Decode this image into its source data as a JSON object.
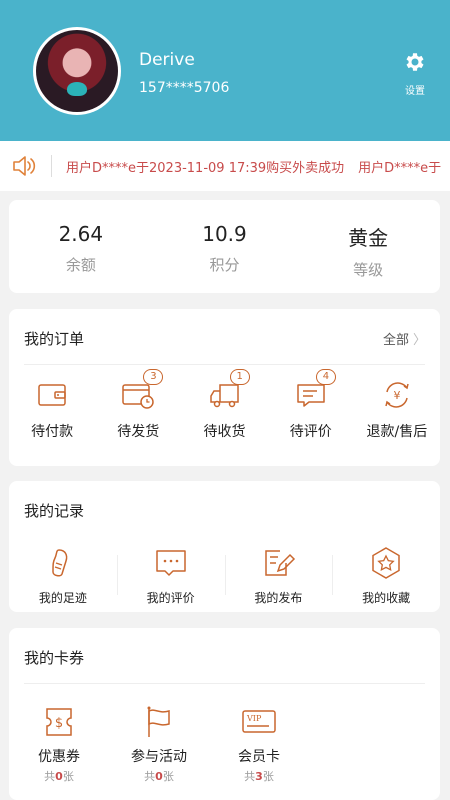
{
  "colors": {
    "header_bg": "#4ab3cb",
    "accent": "#c9672e",
    "marquee_text": "#c84b4b"
  },
  "header": {
    "username": "Derive",
    "phone": "157****5706",
    "settings_label": "设置"
  },
  "marquee": {
    "icon": "speaker-icon",
    "items": [
      "用户D****e于2023-11-09 17:39购买外卖成功",
      "用户D****e于"
    ]
  },
  "stats": [
    {
      "value": "2.64",
      "label": "余额"
    },
    {
      "value": "10.9",
      "label": "积分"
    },
    {
      "value": "黄金",
      "label": "等级"
    }
  ],
  "orders": {
    "title": "我的订单",
    "more": "全部",
    "items": [
      {
        "label": "待付款",
        "icon": "wallet-icon",
        "badge": ""
      },
      {
        "label": "待发货",
        "icon": "card-clock-icon",
        "badge": "3"
      },
      {
        "label": "待收货",
        "icon": "truck-icon",
        "badge": "1"
      },
      {
        "label": "待评价",
        "icon": "comment-icon",
        "badge": "4"
      },
      {
        "label": "退款/售后",
        "icon": "refund-icon",
        "badge": ""
      }
    ]
  },
  "records": {
    "title": "我的记录",
    "items": [
      {
        "label": "我的足迹",
        "icon": "footprint-icon"
      },
      {
        "label": "我的评价",
        "icon": "review-icon"
      },
      {
        "label": "我的发布",
        "icon": "publish-icon"
      },
      {
        "label": "我的收藏",
        "icon": "favorite-icon"
      }
    ]
  },
  "coupons": {
    "title": "我的卡券",
    "items": [
      {
        "label": "优惠券",
        "icon": "coupon-icon",
        "prefix": "共",
        "count": "0",
        "suffix": "张"
      },
      {
        "label": "参与活动",
        "icon": "flag-icon",
        "prefix": "共",
        "count": "0",
        "suffix": "张"
      },
      {
        "label": "会员卡",
        "icon": "vip-card-icon",
        "prefix": "共",
        "count": "3",
        "suffix": "张"
      }
    ]
  }
}
